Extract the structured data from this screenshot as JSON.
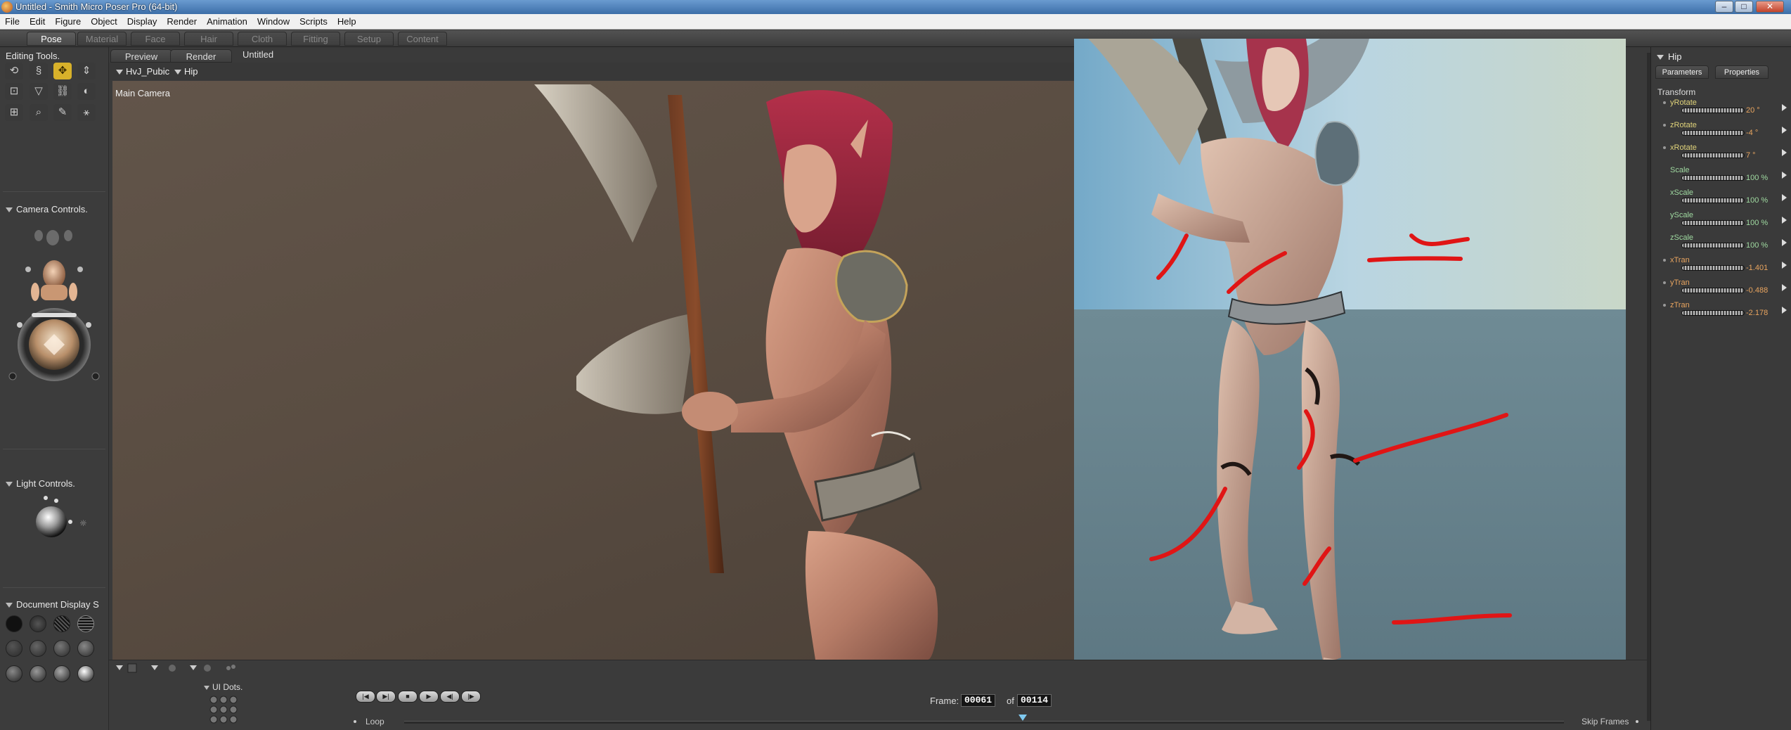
{
  "window": {
    "title": "Untitled - Smith Micro Poser Pro  (64-bit)"
  },
  "menu": [
    "File",
    "Edit",
    "Figure",
    "Object",
    "Display",
    "Render",
    "Animation",
    "Window",
    "Scripts",
    "Help"
  ],
  "rooms": [
    "Pose",
    "Material",
    "Face",
    "Hair",
    "Cloth",
    "Fitting",
    "Setup",
    "Content"
  ],
  "left_panel": {
    "editing_tools": "Editing Tools.",
    "camera_controls": "Camera Controls.",
    "light_controls": "Light Controls.",
    "document_display": "Document Display S"
  },
  "document": {
    "tabs": [
      "Preview",
      "Render"
    ],
    "title": "Untitled",
    "actor_menu": "HvJ_Pubic",
    "part_menu": "Hip",
    "camera_label": "Main Camera"
  },
  "timeline": {
    "ui_dots": "UI Dots.",
    "frame_label": "Frame:",
    "frame_current": "00061",
    "frame_of": "of",
    "frame_total": "00114",
    "loop_label": "Loop",
    "skip_frames": "Skip Frames"
  },
  "right_panel": {
    "title": "Hip",
    "tabs": [
      "Parameters",
      "Properties"
    ],
    "group": "Transform",
    "params": [
      {
        "name": "yRotate",
        "value": "20 °"
      },
      {
        "name": "zRotate",
        "value": "-4 °"
      },
      {
        "name": "xRotate",
        "value": "7 °"
      },
      {
        "name": "Scale",
        "value": "100 %"
      },
      {
        "name": "xScale",
        "value": "100 %"
      },
      {
        "name": "yScale",
        "value": "100 %"
      },
      {
        "name": "zScale",
        "value": "100 %"
      },
      {
        "name": "xTran",
        "value": "-1.401"
      },
      {
        "name": "yTran",
        "value": "-0.488"
      },
      {
        "name": "zTran",
        "value": "-2.178"
      }
    ]
  },
  "colors": {
    "active_tool": "#d8b12a",
    "annotation_red": "#e01515"
  }
}
